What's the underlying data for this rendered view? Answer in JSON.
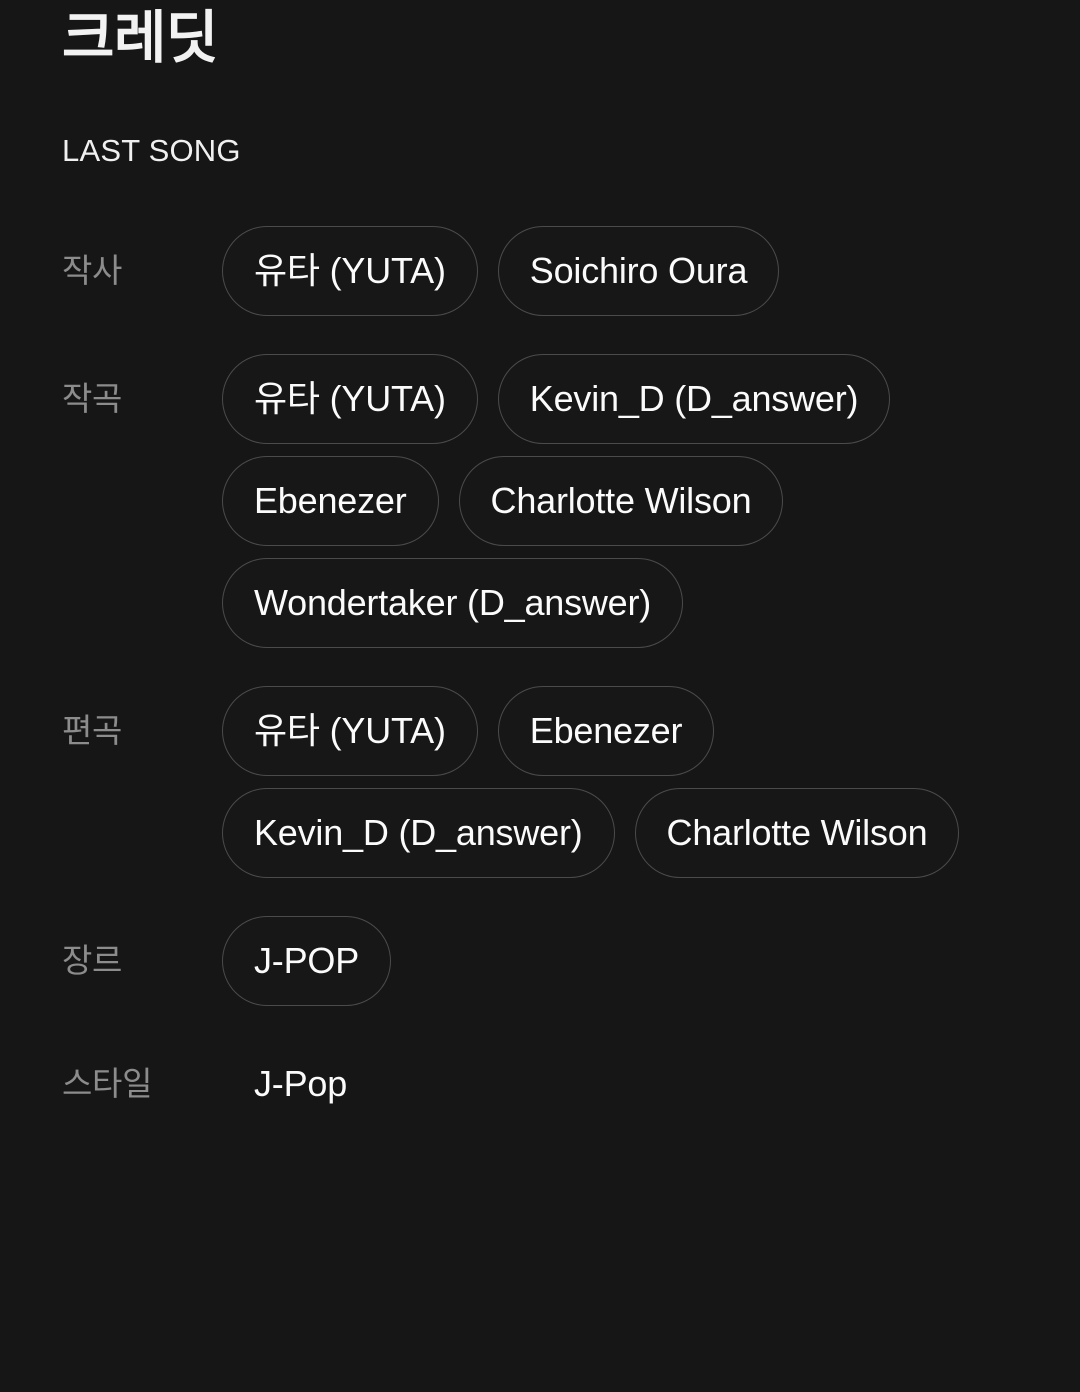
{
  "header": {
    "title": "크레딧",
    "song_title": "LAST SONG"
  },
  "colors": {
    "background": "#161616",
    "label_text": "#8c8c8c",
    "value_text": "#fbfbfb",
    "pill_border": "#4b4b4b",
    "title_text": "#f2f2f2"
  },
  "credits": [
    {
      "label": "작사",
      "style": "pill",
      "values": [
        "유타 (YUTA)",
        "Soichiro Oura"
      ]
    },
    {
      "label": "작곡",
      "style": "pill",
      "values": [
        "유타 (YUTA)",
        "Kevin_D (D_answer)",
        "Ebenezer",
        "Charlotte Wilson",
        "Wondertaker (D_answer)"
      ]
    },
    {
      "label": "편곡",
      "style": "pill",
      "values": [
        "유타 (YUTA)",
        "Ebenezer",
        "Kevin_D (D_answer)",
        "Charlotte Wilson"
      ]
    },
    {
      "label": "장르",
      "style": "pill",
      "values": [
        "J-POP"
      ]
    },
    {
      "label": "스타일",
      "style": "plain",
      "values": [
        "J-Pop"
      ]
    }
  ]
}
